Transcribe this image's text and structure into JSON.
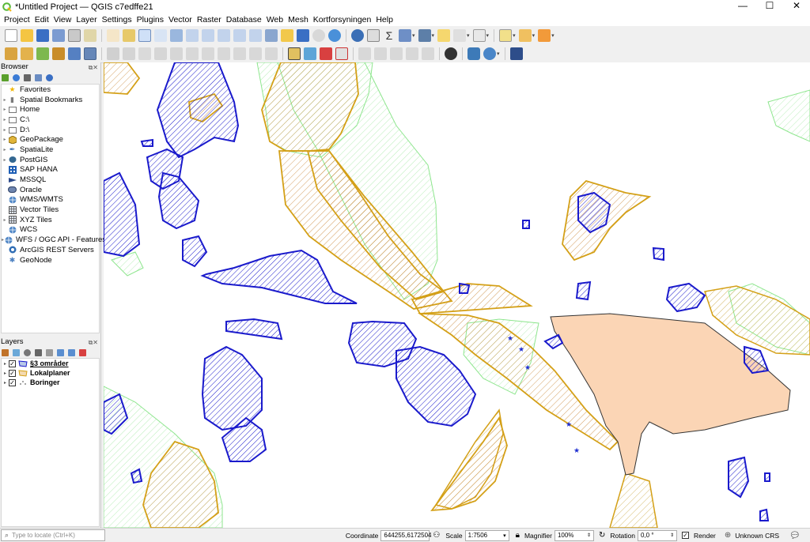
{
  "window": {
    "title": "*Untitled Project — QGIS c7edffe21",
    "minimize": "—",
    "maximize": "☐",
    "close": "✕"
  },
  "menu": [
    "Project",
    "Edit",
    "View",
    "Layer",
    "Settings",
    "Plugins",
    "Vector",
    "Raster",
    "Database",
    "Web",
    "Mesh",
    "Kortforsyningen",
    "Help"
  ],
  "browser": {
    "title": "Browser",
    "items": [
      {
        "label": "Favorites",
        "icon": "star-icon"
      },
      {
        "label": "Spatial Bookmarks",
        "icon": "bookmark-icon"
      },
      {
        "label": "Home",
        "icon": "home-folder-icon"
      },
      {
        "label": "C:\\",
        "icon": "drive-icon"
      },
      {
        "label": "D:\\",
        "icon": "drive-icon"
      },
      {
        "label": "GeoPackage",
        "icon": "geopackage-icon"
      },
      {
        "label": "SpatiaLite",
        "icon": "spatialite-icon"
      },
      {
        "label": "PostGIS",
        "icon": "postgis-icon"
      },
      {
        "label": "SAP HANA",
        "icon": "sap-hana-icon"
      },
      {
        "label": "MSSQL",
        "icon": "mssql-icon"
      },
      {
        "label": "Oracle",
        "icon": "oracle-icon"
      },
      {
        "label": "WMS/WMTS",
        "icon": "globe-icon"
      },
      {
        "label": "Vector Tiles",
        "icon": "grid-icon"
      },
      {
        "label": "XYZ Tiles",
        "icon": "grid-icon"
      },
      {
        "label": "WCS",
        "icon": "globe-icon"
      },
      {
        "label": "WFS / OGC API - Features",
        "icon": "globe-icon"
      },
      {
        "label": "ArcGIS REST Servers",
        "icon": "arcgis-icon"
      },
      {
        "label": "GeoNode",
        "icon": "geonode-icon"
      }
    ]
  },
  "layers": {
    "title": "Layers",
    "items": [
      {
        "label": "§3 områder",
        "checked": true,
        "underline": true
      },
      {
        "label": "Lokalplaner",
        "checked": true,
        "underline": false
      },
      {
        "label": "Boringer",
        "checked": true,
        "underline": false
      }
    ]
  },
  "status": {
    "locator_placeholder": "Type to locate (Ctrl+K)",
    "coordinate_label": "Coordinate",
    "coordinate_value": "644255,6172504",
    "scale_label": "Scale",
    "scale_value": "1:7506",
    "magnifier_label": "Magnifier",
    "magnifier_value": "100%",
    "rotation_label": "Rotation",
    "rotation_value": "0,0 °",
    "render_label": "Render",
    "crs_label": "Unknown CRS"
  },
  "colors": {
    "section3_stroke": "#1a1acc",
    "lokalplan_stroke": "#d4a017",
    "lokalplan_fill": "#e8b07a",
    "green_stroke": "#8ee68e",
    "selected_fill": "#fbd5b5",
    "boring_marker": "#1f2fd0"
  }
}
